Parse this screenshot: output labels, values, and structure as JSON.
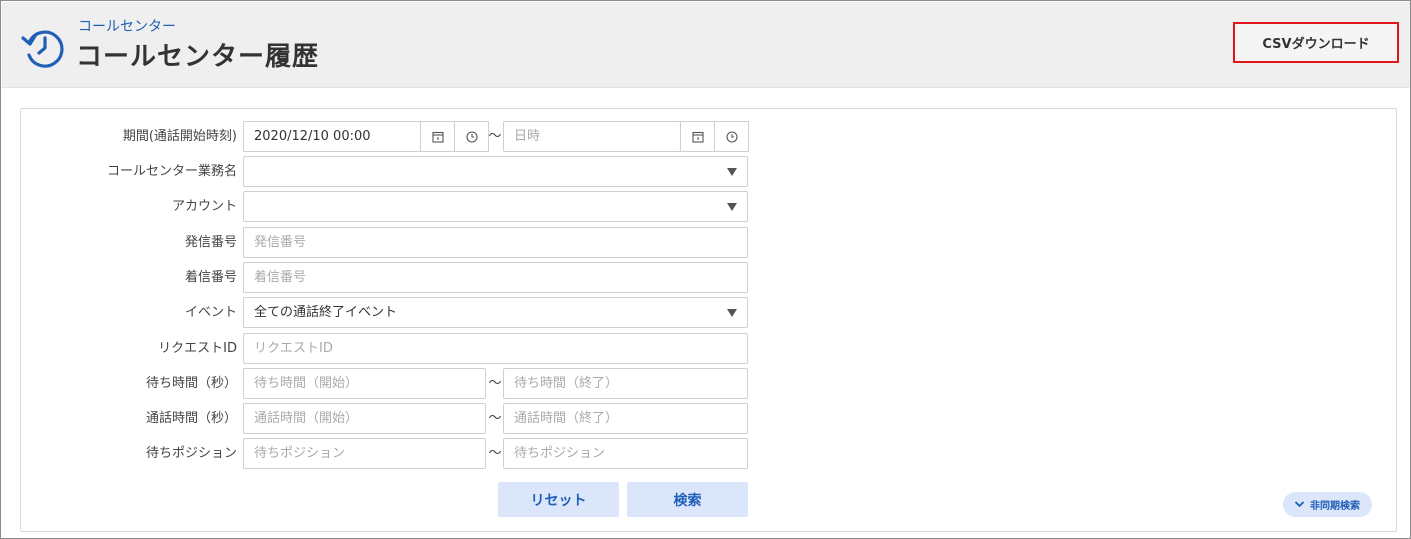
{
  "header": {
    "breadcrumb": "コールセンター",
    "title": "コールセンター履歴",
    "csv_button": "CSVダウンロード",
    "icon": "history-icon"
  },
  "form": {
    "period": {
      "label": "期間(通話開始時刻)",
      "start_value": "2020/12/10 00:00",
      "end_placeholder": "日時",
      "separator": "～"
    },
    "business": {
      "label": "コールセンター業務名",
      "value": ""
    },
    "account": {
      "label": "アカウント",
      "value": ""
    },
    "caller": {
      "label": "発信番号",
      "placeholder": "発信番号"
    },
    "callee": {
      "label": "着信番号",
      "placeholder": "着信番号"
    },
    "event": {
      "label": "イベント",
      "value": "全ての通話終了イベント"
    },
    "request_id": {
      "label": "リクエストID",
      "placeholder": "リクエストID"
    },
    "wait_time": {
      "label": "待ち時間（秒）",
      "start_placeholder": "待ち時間（開始）",
      "end_placeholder": "待ち時間（終了）",
      "separator": "～"
    },
    "talk_time": {
      "label": "通話時間（秒）",
      "start_placeholder": "通話時間（開始）",
      "end_placeholder": "通話時間（終了）",
      "separator": "～"
    },
    "wait_position": {
      "label": "待ちポジション",
      "start_placeholder": "待ちポジション",
      "end_placeholder": "待ちポジション",
      "separator": "～"
    }
  },
  "buttons": {
    "reset": "リセット",
    "search": "検索",
    "async_search": "非同期検索"
  },
  "colors": {
    "accent": "#1f5fb5",
    "csv_border": "#e0161d",
    "button_bg": "#dbe6fb",
    "header_bg": "#efefef"
  }
}
